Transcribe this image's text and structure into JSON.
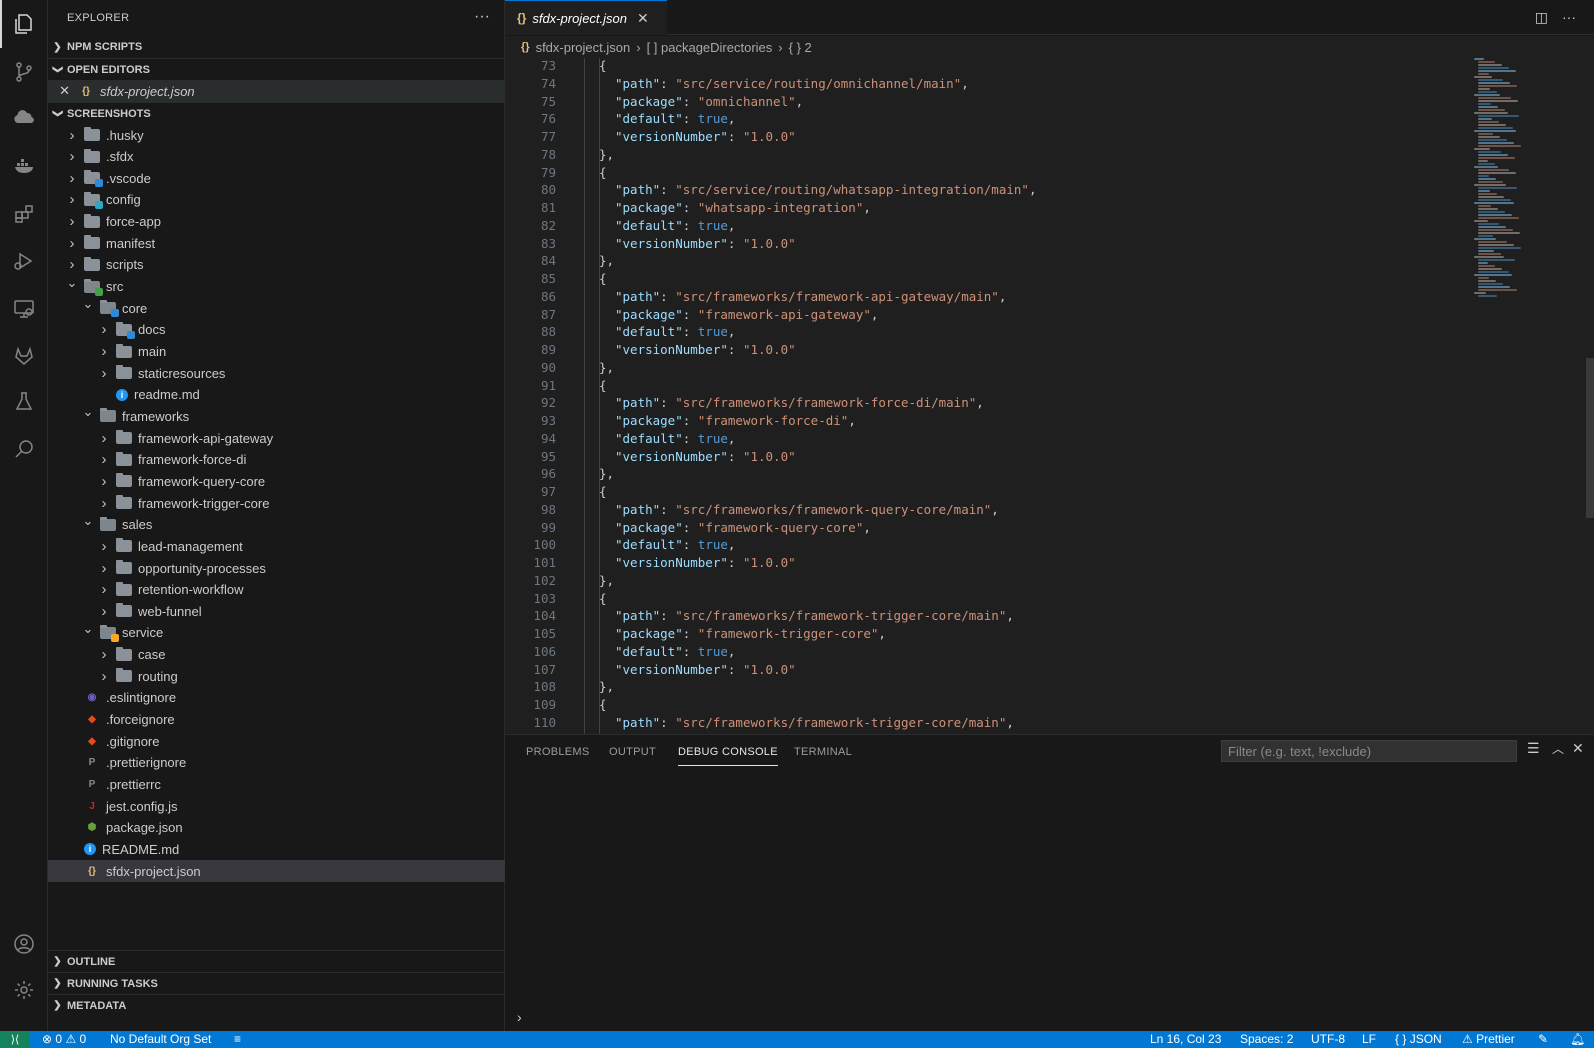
{
  "sidebar": {
    "title": "EXPLORER",
    "sections": {
      "npm_scripts": "NPM SCRIPTS",
      "open_editors": "OPEN EDITORS",
      "workspace": "SCREENSHOTS",
      "outline": "OUTLINE",
      "running_tasks": "RUNNING TASKS",
      "metadata": "METADATA"
    },
    "open_editors": [
      {
        "label": "sfdx-project.json"
      }
    ],
    "tree": [
      {
        "label": ".husky",
        "depth": 0,
        "type": "folder",
        "expanded": false,
        "icon": "husky-folder-icon"
      },
      {
        "label": ".sfdx",
        "depth": 0,
        "type": "folder",
        "expanded": false,
        "icon": "folder-icon"
      },
      {
        "label": ".vscode",
        "depth": 0,
        "type": "folder",
        "expanded": false,
        "icon": "vscode-folder-icon"
      },
      {
        "label": "config",
        "depth": 0,
        "type": "folder",
        "expanded": false,
        "icon": "config-folder-icon"
      },
      {
        "label": "force-app",
        "depth": 0,
        "type": "folder",
        "expanded": false,
        "icon": "folder-icon"
      },
      {
        "label": "manifest",
        "depth": 0,
        "type": "folder",
        "expanded": false,
        "icon": "folder-icon"
      },
      {
        "label": "scripts",
        "depth": 0,
        "type": "folder",
        "expanded": false,
        "icon": "scripts-folder-icon"
      },
      {
        "label": "src",
        "depth": 0,
        "type": "folder",
        "expanded": true,
        "icon": "src-folder-icon"
      },
      {
        "label": "core",
        "depth": 1,
        "type": "folder",
        "expanded": true,
        "icon": "core-folder-icon"
      },
      {
        "label": "docs",
        "depth": 2,
        "type": "folder",
        "expanded": false,
        "icon": "docs-folder-icon"
      },
      {
        "label": "main",
        "depth": 2,
        "type": "folder",
        "expanded": false,
        "icon": "folder-icon"
      },
      {
        "label": "staticresources",
        "depth": 2,
        "type": "folder",
        "expanded": false,
        "icon": "folder-icon"
      },
      {
        "label": "readme.md",
        "depth": 2,
        "type": "file",
        "icon": "info-file-icon"
      },
      {
        "label": "frameworks",
        "depth": 1,
        "type": "folder",
        "expanded": true,
        "icon": "folder-open-icon"
      },
      {
        "label": "framework-api-gateway",
        "depth": 2,
        "type": "folder",
        "expanded": false,
        "icon": "folder-icon"
      },
      {
        "label": "framework-force-di",
        "depth": 2,
        "type": "folder",
        "expanded": false,
        "icon": "folder-icon"
      },
      {
        "label": "framework-query-core",
        "depth": 2,
        "type": "folder",
        "expanded": false,
        "icon": "folder-icon"
      },
      {
        "label": "framework-trigger-core",
        "depth": 2,
        "type": "folder",
        "expanded": false,
        "icon": "folder-icon"
      },
      {
        "label": "sales",
        "depth": 1,
        "type": "folder",
        "expanded": true,
        "icon": "folder-open-icon"
      },
      {
        "label": "lead-management",
        "depth": 2,
        "type": "folder",
        "expanded": false,
        "icon": "folder-icon"
      },
      {
        "label": "opportunity-processes",
        "depth": 2,
        "type": "folder",
        "expanded": false,
        "icon": "folder-icon"
      },
      {
        "label": "retention-workflow",
        "depth": 2,
        "type": "folder",
        "expanded": false,
        "icon": "folder-icon"
      },
      {
        "label": "web-funnel",
        "depth": 2,
        "type": "folder",
        "expanded": false,
        "icon": "folder-icon"
      },
      {
        "label": "service",
        "depth": 1,
        "type": "folder",
        "expanded": true,
        "icon": "service-folder-icon"
      },
      {
        "label": "case",
        "depth": 2,
        "type": "folder",
        "expanded": false,
        "icon": "folder-icon"
      },
      {
        "label": "routing",
        "depth": 2,
        "type": "folder",
        "expanded": false,
        "icon": "folder-icon"
      },
      {
        "label": ".eslintignore",
        "depth": 0,
        "type": "file",
        "icon": "eslint-file-icon"
      },
      {
        "label": ".forceignore",
        "depth": 0,
        "type": "file",
        "icon": "salesforce-file-icon"
      },
      {
        "label": ".gitignore",
        "depth": 0,
        "type": "file",
        "icon": "git-file-icon"
      },
      {
        "label": ".prettierignore",
        "depth": 0,
        "type": "file",
        "icon": "prettier-file-icon"
      },
      {
        "label": ".prettierrc",
        "depth": 0,
        "type": "file",
        "icon": "prettier-file-icon"
      },
      {
        "label": "jest.config.js",
        "depth": 0,
        "type": "file",
        "icon": "jest-file-icon"
      },
      {
        "label": "package.json",
        "depth": 0,
        "type": "file",
        "icon": "nodejs-file-icon"
      },
      {
        "label": "README.md",
        "depth": 0,
        "type": "file",
        "icon": "info-file-icon"
      },
      {
        "label": "sfdx-project.json",
        "depth": 0,
        "type": "file",
        "icon": "json-file-icon",
        "selected": true
      }
    ]
  },
  "editor": {
    "tab": {
      "label": "sfdx-project.json"
    },
    "breadcrumb": [
      "sfdx-project.json",
      "[ ] packageDirectories",
      "{ } 2"
    ],
    "lines": [
      {
        "n": "73",
        "t": "{"
      },
      {
        "n": "74",
        "k": "\"path\"",
        "v": "\"src/service/routing/omnichannel/main\"",
        "vt": "s"
      },
      {
        "n": "75",
        "k": "\"package\"",
        "v": "\"omnichannel\"",
        "vt": "s"
      },
      {
        "n": "76",
        "k": "\"default\"",
        "v": "true",
        "vt": "b"
      },
      {
        "n": "77",
        "k": "\"versionNumber\"",
        "v": "\"1.0.0\"",
        "vt": "s",
        "last": true
      },
      {
        "n": "78",
        "t": "},"
      },
      {
        "n": "79",
        "t": "{"
      },
      {
        "n": "80",
        "k": "\"path\"",
        "v": "\"src/service/routing/whatsapp-integration/main\"",
        "vt": "s"
      },
      {
        "n": "81",
        "k": "\"package\"",
        "v": "\"whatsapp-integration\"",
        "vt": "s"
      },
      {
        "n": "82",
        "k": "\"default\"",
        "v": "true",
        "vt": "b"
      },
      {
        "n": "83",
        "k": "\"versionNumber\"",
        "v": "\"1.0.0\"",
        "vt": "s",
        "last": true
      },
      {
        "n": "84",
        "t": "},"
      },
      {
        "n": "85",
        "t": "{"
      },
      {
        "n": "86",
        "k": "\"path\"",
        "v": "\"src/frameworks/framework-api-gateway/main\"",
        "vt": "s"
      },
      {
        "n": "87",
        "k": "\"package\"",
        "v": "\"framework-api-gateway\"",
        "vt": "s"
      },
      {
        "n": "88",
        "k": "\"default\"",
        "v": "true",
        "vt": "b"
      },
      {
        "n": "89",
        "k": "\"versionNumber\"",
        "v": "\"1.0.0\"",
        "vt": "s",
        "last": true
      },
      {
        "n": "90",
        "t": "},"
      },
      {
        "n": "91",
        "t": "{"
      },
      {
        "n": "92",
        "k": "\"path\"",
        "v": "\"src/frameworks/framework-force-di/main\"",
        "vt": "s"
      },
      {
        "n": "93",
        "k": "\"package\"",
        "v": "\"framework-force-di\"",
        "vt": "s"
      },
      {
        "n": "94",
        "k": "\"default\"",
        "v": "true",
        "vt": "b"
      },
      {
        "n": "95",
        "k": "\"versionNumber\"",
        "v": "\"1.0.0\"",
        "vt": "s",
        "last": true
      },
      {
        "n": "96",
        "t": "},"
      },
      {
        "n": "97",
        "t": "{"
      },
      {
        "n": "98",
        "k": "\"path\"",
        "v": "\"src/frameworks/framework-query-core/main\"",
        "vt": "s"
      },
      {
        "n": "99",
        "k": "\"package\"",
        "v": "\"framework-query-core\"",
        "vt": "s"
      },
      {
        "n": "100",
        "k": "\"default\"",
        "v": "true",
        "vt": "b"
      },
      {
        "n": "101",
        "k": "\"versionNumber\"",
        "v": "\"1.0.0\"",
        "vt": "s",
        "last": true
      },
      {
        "n": "102",
        "t": "},"
      },
      {
        "n": "103",
        "t": "{"
      },
      {
        "n": "104",
        "k": "\"path\"",
        "v": "\"src/frameworks/framework-trigger-core/main\"",
        "vt": "s"
      },
      {
        "n": "105",
        "k": "\"package\"",
        "v": "\"framework-trigger-core\"",
        "vt": "s"
      },
      {
        "n": "106",
        "k": "\"default\"",
        "v": "true",
        "vt": "b"
      },
      {
        "n": "107",
        "k": "\"versionNumber\"",
        "v": "\"1.0.0\"",
        "vt": "s",
        "last": true
      },
      {
        "n": "108",
        "t": "},"
      },
      {
        "n": "109",
        "t": "{"
      },
      {
        "n": "110",
        "k": "\"path\"",
        "v": "\"src/frameworks/framework-trigger-core/main\"",
        "vt": "s"
      }
    ]
  },
  "panel": {
    "tabs": [
      "PROBLEMS",
      "OUTPUT",
      "DEBUG CONSOLE",
      "TERMINAL"
    ],
    "active_tab": "DEBUG CONSOLE",
    "filter_placeholder": "Filter (e.g. text, !exclude)",
    "prompt": "›"
  },
  "status": {
    "errors": "0",
    "warnings": "0",
    "org": "No Default Org Set",
    "position": "Ln 16, Col 23",
    "spaces": "Spaces: 2",
    "encoding": "UTF-8",
    "eol": "LF",
    "language": "JSON",
    "formatter": "Prettier"
  },
  "colors": {
    "accent": "#0078d4",
    "json_icon": "#e5c07b",
    "string": "#ce9178",
    "key": "#9cdcfe",
    "boolean": "#569cd6"
  }
}
